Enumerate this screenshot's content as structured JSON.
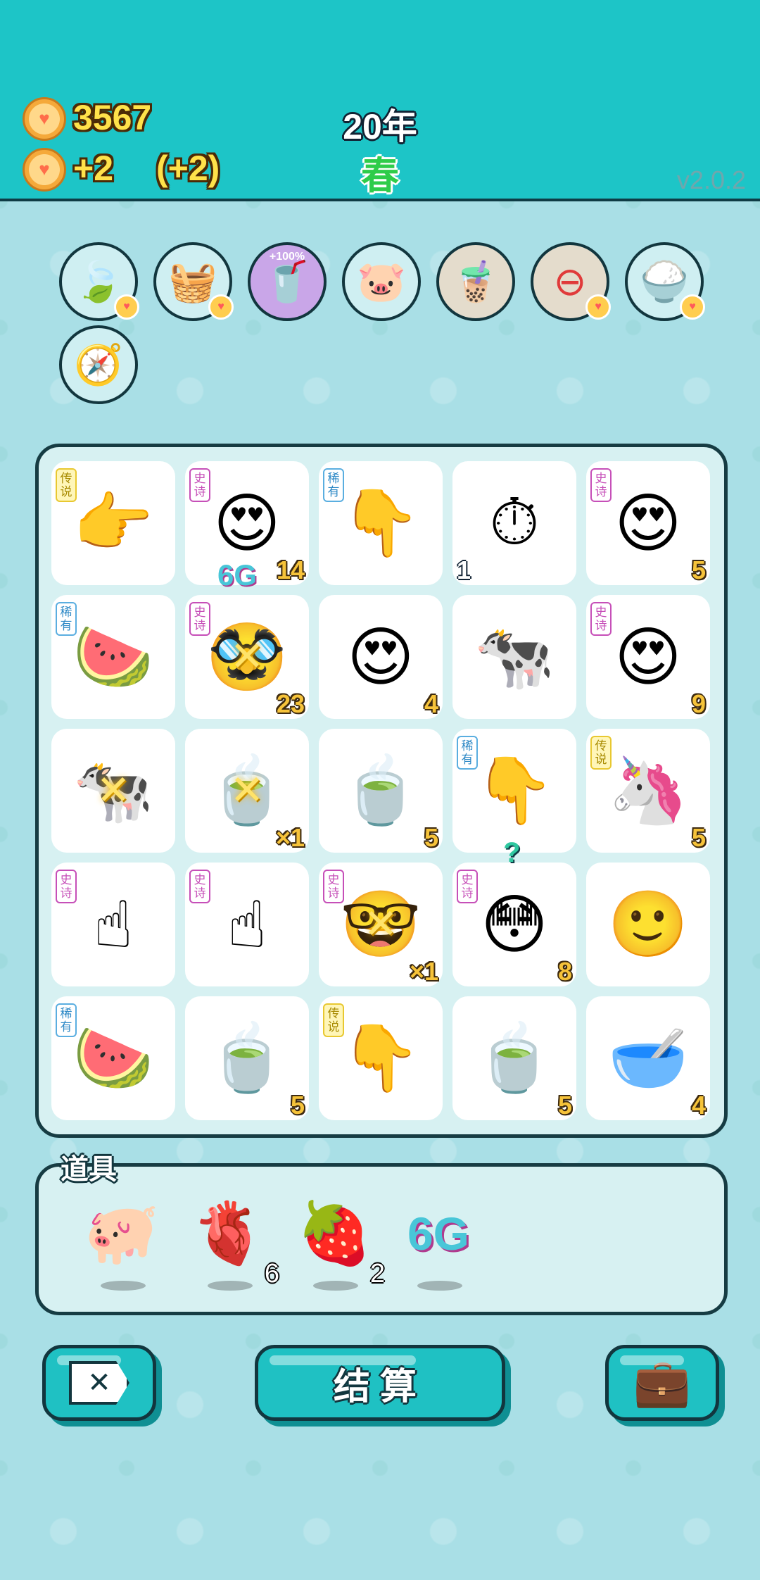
{
  "header": {
    "coins": "3567",
    "income": "+2",
    "income_bonus": "(+2)",
    "year": "20年",
    "season": "春",
    "version": "v2.0.2"
  },
  "buffs": [
    {
      "icon": "leaf-icon",
      "glyph": "🍃"
    },
    {
      "icon": "fruit-basket-icon",
      "glyph": "🧺"
    },
    {
      "icon": "milk-tea-boost-icon",
      "glyph": "🥤",
      "label": "+100%"
    },
    {
      "icon": "piggy-bank-icon",
      "glyph": "🐷"
    },
    {
      "icon": "bubble-tea-icon",
      "glyph": "🧋"
    },
    {
      "icon": "minus-circle-icon",
      "glyph": "⊖"
    },
    {
      "icon": "rice-bowl-icon",
      "glyph": "🍚"
    },
    {
      "icon": "compass-icon",
      "glyph": "🧭"
    }
  ],
  "board": {
    "cells": [
      {
        "name": "pointing-hand-legend",
        "glyph": "👉",
        "tag": "传说",
        "tag_type": "legend",
        "num": ""
      },
      {
        "name": "girl-heart-eyes",
        "glyph": "😍",
        "tag": "史诗",
        "tag_type": "epic",
        "num": "14",
        "overlay": "6G"
      },
      {
        "name": "pointing-hand-brown",
        "glyph": "👇",
        "tag": "稀有",
        "tag_type": "rare",
        "num": ""
      },
      {
        "name": "stopwatch-card",
        "glyph": "⏱",
        "tag": "",
        "tag_type": "",
        "num": "1",
        "num_left": true
      },
      {
        "name": "bald-man-heart-eyes",
        "glyph": "😍",
        "tag": "史诗",
        "tag_type": "epic",
        "num": "5"
      },
      {
        "name": "watermelon",
        "glyph": "🍉",
        "tag": "稀有",
        "tag_type": "rare",
        "num": ""
      },
      {
        "name": "green-hair-man",
        "glyph": "🥸",
        "tag": "史诗",
        "tag_type": "epic",
        "num": "23",
        "xmark": true
      },
      {
        "name": "man-heart-eyes",
        "glyph": "😍",
        "tag": "",
        "tag_type": "",
        "num": "4"
      },
      {
        "name": "cow-milk-carton",
        "glyph": "🐄",
        "tag": "",
        "tag_type": "",
        "num": ""
      },
      {
        "name": "girl-braids-hearts",
        "glyph": "😍",
        "tag": "史诗",
        "tag_type": "epic",
        "num": "9"
      },
      {
        "name": "cow-carton-crossed",
        "glyph": "🐄",
        "tag": "",
        "tag_type": "",
        "num": "",
        "xmark": true
      },
      {
        "name": "tea-bag-crossed",
        "glyph": "🍵",
        "tag": "",
        "tag_type": "",
        "num": "×1",
        "xmark": true
      },
      {
        "name": "tea-bowl",
        "glyph": "🍵",
        "tag": "",
        "tag_type": "",
        "num": "5"
      },
      {
        "name": "pointing-hand-down-brown",
        "glyph": "👇",
        "tag": "稀有",
        "tag_type": "rare",
        "num": ""
      },
      {
        "name": "unicorn",
        "glyph": "🦄",
        "tag": "传说",
        "tag_type": "legend",
        "num": "5"
      },
      {
        "name": "grey-hand-1",
        "glyph": "☝",
        "tag": "史诗",
        "tag_type": "epic",
        "num": ""
      },
      {
        "name": "grey-hand-2",
        "glyph": "☝",
        "tag": "史诗",
        "tag_type": "epic",
        "num": ""
      },
      {
        "name": "green-hair-glasses-man",
        "glyph": "🤓",
        "tag": "史诗",
        "tag_type": "epic",
        "num": "×1",
        "xmark": true
      },
      {
        "name": "red-face-glasses",
        "glyph": "😳",
        "tag": "史诗",
        "tag_type": "epic",
        "num": "8",
        "question": "?"
      },
      {
        "name": "plain-man-face",
        "glyph": "🙂",
        "tag": "",
        "tag_type": "",
        "num": ""
      },
      {
        "name": "watermelon-2",
        "glyph": "🍉",
        "tag": "稀有",
        "tag_type": "rare",
        "num": ""
      },
      {
        "name": "tea-bowl-2",
        "glyph": "🍵",
        "tag": "",
        "tag_type": "",
        "num": "5"
      },
      {
        "name": "pointing-hand-yellow-down",
        "glyph": "👇",
        "tag": "传说",
        "tag_type": "legend",
        "num": ""
      },
      {
        "name": "tea-bowl-3",
        "glyph": "🍵",
        "tag": "",
        "tag_type": "",
        "num": "5"
      },
      {
        "name": "empty-bowl",
        "glyph": "🥣",
        "tag": "",
        "tag_type": "",
        "num": "4"
      }
    ]
  },
  "items": {
    "title": "道具",
    "list": [
      {
        "icon": "piggy-bank-icon",
        "glyph": "🐖",
        "count": ""
      },
      {
        "icon": "liver-icon",
        "glyph": "🫀",
        "count": "6"
      },
      {
        "icon": "strawberry-icon",
        "glyph": "🍓",
        "count": "2"
      },
      {
        "icon": "6g-icon",
        "glyph": "6G",
        "count": ""
      }
    ]
  },
  "buttons": {
    "exit_glyph": "✕",
    "settle_label": "结算",
    "bag_glyph": "💼"
  }
}
